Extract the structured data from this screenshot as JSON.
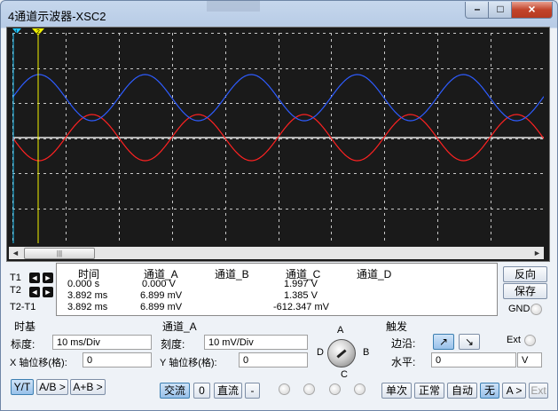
{
  "window": {
    "title": "4通道示波器-XSC2",
    "minimize_glyph": "–",
    "maximize_glyph": "□",
    "close_glyph": "×"
  },
  "screen": {
    "trace_a_color": "#ff2222",
    "trace_c_color": "#2e5cff",
    "grid_color": "#c8c8c8",
    "cursor1_color": "#22c8ff",
    "cursor2_color": "#f2f200",
    "cursor1_label": "1",
    "cursor2_label": "2"
  },
  "scrollbar": {
    "left": "◄",
    "thumb": "|||",
    "right": "►"
  },
  "cursors": {
    "t1": "T1",
    "t2": "T2",
    "t2t1": "T2-T1",
    "left_glyph": "◄",
    "right_glyph": "►"
  },
  "readout": {
    "headers": [
      "时间",
      "通道_A",
      "通道_B",
      "通道_C",
      "通道_D"
    ],
    "rows": [
      [
        "0.000 s",
        "0.000 V",
        "",
        "1.997 V",
        ""
      ],
      [
        "3.892 ms",
        "6.899 mV",
        "",
        "1.385 V",
        ""
      ],
      [
        "3.892 ms",
        "6.899 mV",
        "",
        "-612.347 mV",
        ""
      ]
    ]
  },
  "side_buttons": {
    "reverse": "反向",
    "save": "保存",
    "gnd": "GND"
  },
  "timebase": {
    "title": "时基",
    "scale_label": "标度:",
    "scale_value": "10 ms/Div",
    "xpos_label": "X 轴位移(格):",
    "xpos_value": "0",
    "modes": [
      "Y/T",
      "A/B >",
      "A+B >"
    ]
  },
  "channel": {
    "title": "通道_A",
    "scale_label": "刻度:",
    "scale_value": "10 mV/Div",
    "ypos_label": "Y 轴位移(格):",
    "ypos_value": "0",
    "coupling": [
      "交流",
      "0",
      "直流",
      "-"
    ],
    "knob_labels": {
      "a": "A",
      "b": "B",
      "c": "C",
      "d": "D"
    }
  },
  "trigger": {
    "title": "触发",
    "edge_label": "边沿:",
    "edge_rising": "↗",
    "edge_falling": "↘",
    "ext": "Ext",
    "level_label": "水平:",
    "level_value": "0",
    "level_unit": "V",
    "modes": [
      "单次",
      "正常",
      "自动",
      "无",
      "A >",
      "Ext"
    ]
  }
}
